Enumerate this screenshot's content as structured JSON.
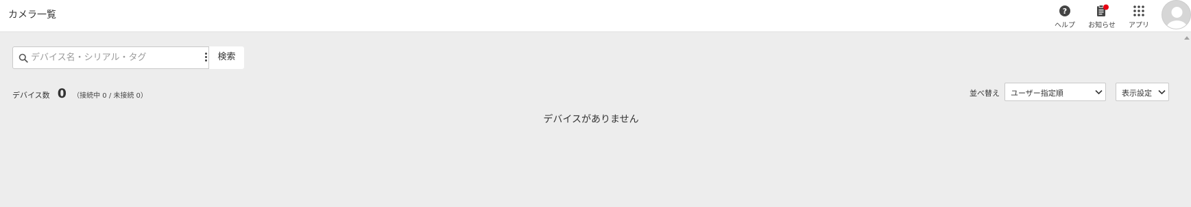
{
  "header": {
    "title": "カメラ一覧",
    "help_label": "ヘルプ",
    "news_label": "お知らせ",
    "apps_label": "アプリ",
    "notification_color": "#e60012"
  },
  "search": {
    "placeholder": "デバイス名・シリアル・タグ",
    "value": "",
    "button_label": "検索"
  },
  "devices": {
    "count_label": "デバイス数",
    "count": "0",
    "detail": "（接続中 0 / 未接続 0）",
    "empty_message": "デバイスがありません"
  },
  "sort": {
    "label": "並べ替え",
    "selected": "ユーザー指定順"
  },
  "display_settings": {
    "label": "表示設定"
  }
}
